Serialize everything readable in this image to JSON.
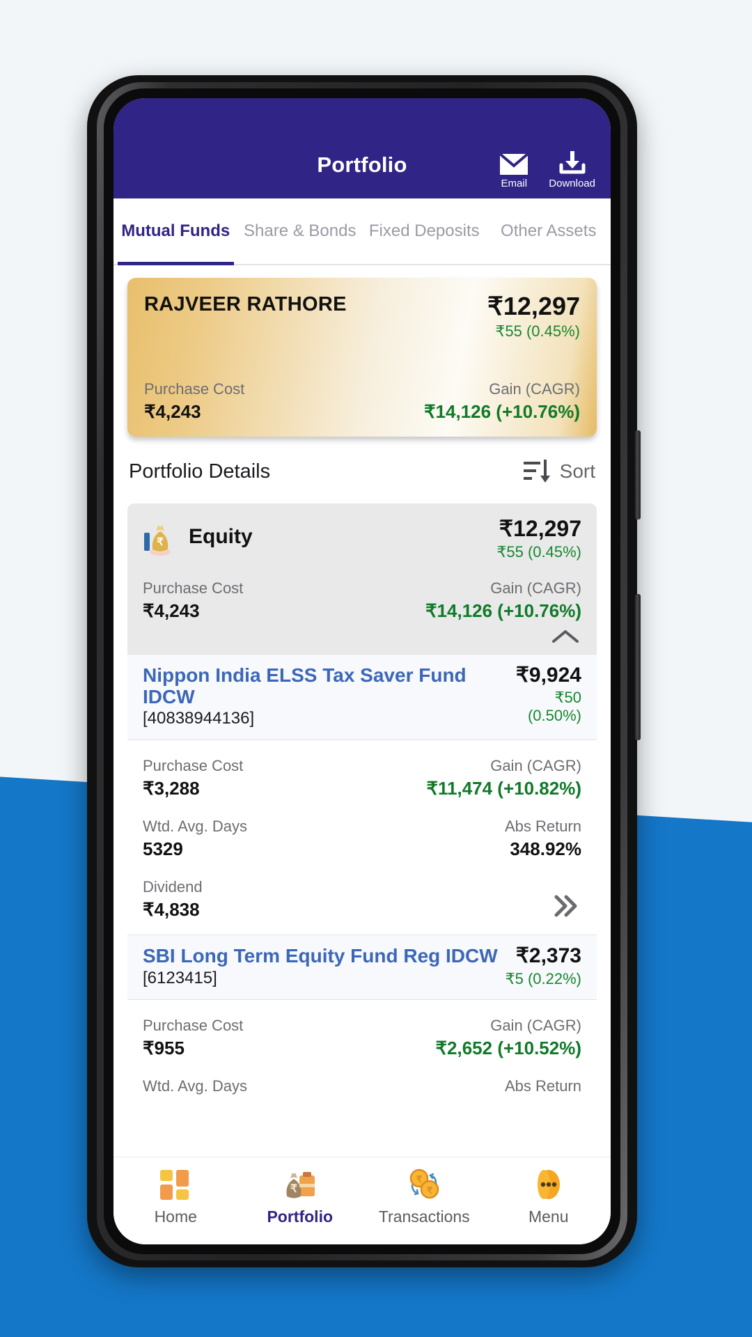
{
  "header": {
    "title": "Portfolio",
    "actions": [
      {
        "icon": "email-icon",
        "label": "Email"
      },
      {
        "icon": "download-icon",
        "label": "Download"
      }
    ]
  },
  "tabs": [
    {
      "label": "Mutual Funds",
      "active": true
    },
    {
      "label": "Share & Bonds",
      "active": false
    },
    {
      "label": "Fixed Deposits",
      "active": false
    },
    {
      "label": "Other Assets",
      "active": false
    }
  ],
  "summary": {
    "name": "RAJVEER RATHORE",
    "value": "₹12,297",
    "day_change": "₹55 (0.45%)",
    "purchase_cost_label": "Purchase Cost",
    "purchase_cost": "₹4,243",
    "gain_label": "Gain (CAGR)",
    "gain": "₹14,126 (+10.76%)"
  },
  "details": {
    "title": "Portfolio Details",
    "sort_label": "Sort",
    "sort_icon": "sort-icon"
  },
  "equity_group": {
    "icon": "money-bag-icon",
    "name": "Equity",
    "value": "₹12,297",
    "day_change": "₹55 (0.45%)",
    "purchase_cost_label": "Purchase Cost",
    "purchase_cost": "₹4,243",
    "gain_label": "Gain (CAGR)",
    "gain": "₹14,126 (+10.76%)",
    "collapse_icon": "chevron-up-icon"
  },
  "funds": [
    {
      "name": "Nippon India ELSS Tax Saver Fund IDCW",
      "folio": "[40838944136]",
      "value": "₹9,924",
      "day_change": "₹50 (0.50%)",
      "purchase_cost_label": "Purchase Cost",
      "purchase_cost": "₹3,288",
      "gain_label": "Gain (CAGR)",
      "gain": "₹11,474 (+10.82%)",
      "wtd_avg_days_label": "Wtd. Avg. Days",
      "wtd_avg_days": "5329",
      "abs_return_label": "Abs Return",
      "abs_return": "348.92%",
      "dividend_label": "Dividend",
      "dividend": "₹4,838",
      "expand_icon": "double-chevron-right-icon"
    },
    {
      "name": "SBI Long Term Equity Fund Reg IDCW",
      "folio": "[6123415]",
      "value": "₹2,373",
      "day_change": "₹5 (0.22%)",
      "purchase_cost_label": "Purchase Cost",
      "purchase_cost": "₹955",
      "gain_label": "Gain (CAGR)",
      "gain": "₹2,652 (+10.52%)",
      "wtd_avg_days_label": "Wtd. Avg. Days",
      "abs_return_label": "Abs Return"
    }
  ],
  "bottom_nav": [
    {
      "label": "Home",
      "icon": "grid-tiles-icon",
      "active": false
    },
    {
      "label": "Portfolio",
      "icon": "money-bag-briefcase-icon",
      "active": true
    },
    {
      "label": "Transactions",
      "icon": "coins-exchange-icon",
      "active": false
    },
    {
      "label": "Menu",
      "icon": "more-dots-icon",
      "active": false
    }
  ],
  "colors": {
    "brand_purple": "#302486",
    "accent_blue": "#1477c8",
    "positive_green": "#17872f",
    "link_blue": "#3c67b8",
    "gold_card": "#e8bf6c"
  }
}
